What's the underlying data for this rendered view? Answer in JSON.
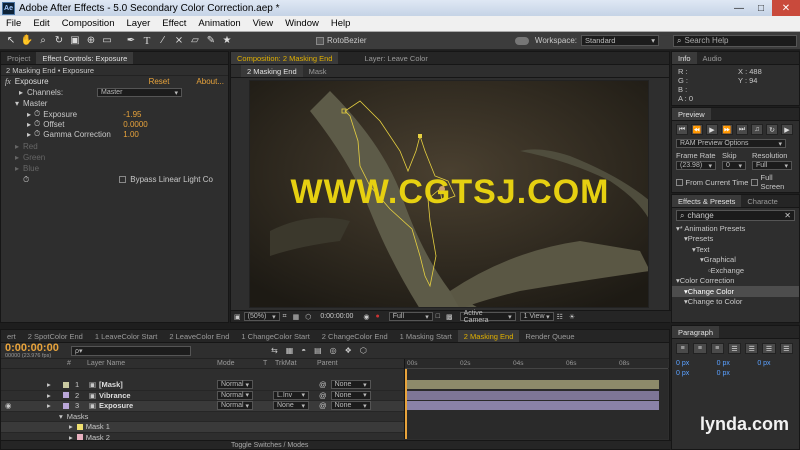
{
  "window": {
    "app_badge": "Ae",
    "title": "Adobe After Effects - 5.0 Secondary Color Correction.aep *"
  },
  "menu": [
    "File",
    "Edit",
    "Composition",
    "Layer",
    "Effect",
    "Animation",
    "View",
    "Window",
    "Help"
  ],
  "toolbar": {
    "rotobezier": "RotoBezier",
    "workspace_label": "Workspace:",
    "workspace_value": "Standard",
    "search_placeholder": "Search Help"
  },
  "left_panel": {
    "tabs": [
      "Project",
      "Effect Controls: Exposure"
    ],
    "breadcrumb": "2 Masking End • Exposure",
    "effect_name": "Exposure",
    "reset": "Reset",
    "about": "About...",
    "channels_label": "Channels:",
    "channels_value": "Master",
    "master_label": "Master",
    "props": [
      {
        "name": "Exposure",
        "value": "-1.95"
      },
      {
        "name": "Offset",
        "value": "0.0000"
      },
      {
        "name": "Gamma Correction",
        "value": "1.00"
      }
    ],
    "channels": [
      "Red",
      "Green",
      "Blue"
    ],
    "bypass": "Bypass Linear Light Co"
  },
  "comp": {
    "tabs": [
      "Composition: 2 Masking End",
      "Layer: Leave Color"
    ],
    "subtabs": [
      "2 Masking End",
      "Mask"
    ],
    "overlay_text": "WWW.CGTSJ.COM",
    "zoom": "(50%)",
    "timecode": "0:00:00:00",
    "resolution": "Full",
    "camera": "Active Camera",
    "view": "1 View"
  },
  "info": {
    "tabs": [
      "Info",
      "Audio"
    ],
    "labels": [
      "R :",
      "G :",
      "B :",
      "A : 0"
    ],
    "coords": [
      "X : 488",
      "Y : 94"
    ]
  },
  "preview": {
    "tab": "Preview",
    "ram": "RAM Preview Options",
    "frame_rate_label": "Frame Rate",
    "frame_rate_value": "(23.98)",
    "skip_label": "Skip",
    "skip_value": "0",
    "resolution_label": "Resolution",
    "resolution_value": "Full",
    "from_current": "From Current Time",
    "full_screen": "Full Screen"
  },
  "effects": {
    "tabs": [
      "Effects & Presets",
      "Characte"
    ],
    "search": "change",
    "tree": [
      {
        "label": "* Animation Presets",
        "indent": 0
      },
      {
        "label": "Presets",
        "indent": 1
      },
      {
        "label": "Text",
        "indent": 2
      },
      {
        "label": "Graphical",
        "indent": 3
      },
      {
        "label": "Exchange",
        "indent": 4
      },
      {
        "label": "Color Correction",
        "indent": 0
      },
      {
        "label": "Change Color",
        "indent": 1,
        "selected": true
      },
      {
        "label": "Change to Color",
        "indent": 1
      }
    ]
  },
  "paragraph": {
    "tab": "Paragraph",
    "fields": [
      "0 px",
      "0 px",
      "0 px",
      "0 px",
      "0 px"
    ]
  },
  "timeline": {
    "tabs": [
      "ert",
      "2 SpotColor End",
      "1 LeaveColor Start",
      "2 LeaveColor End",
      "1 ChangeColor Start",
      "2 ChangeColor End",
      "1 Masking Start",
      "2 Masking End",
      "Render Queue"
    ],
    "timecode": "0:00:00:00",
    "fps": "00000 (23.976 fps)",
    "search_placeholder": "ρ▾",
    "columns": {
      "num": "#",
      "name": "Layer Name",
      "mode": "Mode",
      "t": "T",
      "trkmat": "TrkMat",
      "parent": "Parent"
    },
    "ruler": [
      "00s",
      "02s",
      "04s",
      "06s",
      "08s"
    ],
    "layers": [
      {
        "num": "1",
        "name": "[Mask]",
        "mode": "Normal",
        "trkmat": "",
        "parent": "None",
        "color": "#c9c9a0"
      },
      {
        "num": "2",
        "name": "Vibrance",
        "mode": "Normal",
        "trkmat": "L.Inv",
        "parent": "None",
        "color": "#b9a6d8"
      },
      {
        "num": "3",
        "name": "Exposure",
        "mode": "Normal",
        "trkmat": "None",
        "parent": "None",
        "color": "#b9a6d8"
      }
    ],
    "masks_label": "Masks",
    "masks": [
      {
        "name": "Mask 1",
        "color": "#f0e070"
      },
      {
        "name": "Mask 2",
        "color": "#e8b0c0"
      }
    ],
    "toggle": "Toggle Switches / Modes",
    "watermark": "lynda.com"
  }
}
